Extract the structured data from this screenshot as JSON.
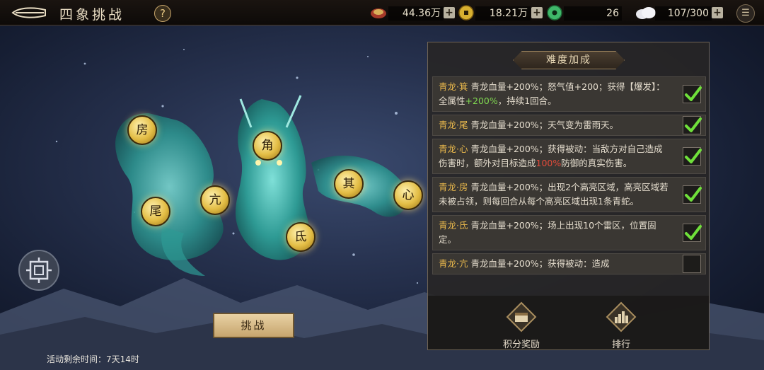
{
  "header": {
    "title": "四象挑战",
    "help_label": "?",
    "menu_label": "☰",
    "resources": [
      {
        "name": "treasure-icon",
        "value": "44.36万"
      },
      {
        "name": "copper-coin-icon",
        "value": "18.21万"
      },
      {
        "name": "jade-icon",
        "value": "26"
      },
      {
        "name": "stamina-cloud-icon",
        "value": "107/300"
      }
    ],
    "plus_label": "+"
  },
  "stars": [
    "房",
    "角",
    "亢",
    "其",
    "心",
    "尾",
    "氐"
  ],
  "panel": {
    "title": "难度加成",
    "rows": [
      {
        "name": "青龙·箕",
        "parts": [
          {
            "t": "青龙血量+200%；怒气值+200；获得【爆发】：全属性"
          },
          {
            "t": "+200%",
            "c": "g"
          },
          {
            "t": "，持续1回合。"
          }
        ],
        "checked": true
      },
      {
        "name": "青龙·尾",
        "parts": [
          {
            "t": "青龙血量+200%；天气变为雷雨天。"
          }
        ],
        "checked": true
      },
      {
        "name": "青龙·心",
        "parts": [
          {
            "t": "青龙血量+200%；获得被动：当敌方对自己造成伤害时，额外对目标造成"
          },
          {
            "t": "100%",
            "c": "r"
          },
          {
            "t": "防御的真实伤害。"
          }
        ],
        "checked": true
      },
      {
        "name": "青龙·房",
        "parts": [
          {
            "t": "青龙血量+200%；出现2个高亮区域，高亮区域若未被占领，则每回合从每个高亮区域出现1条青蛇。"
          }
        ],
        "checked": true
      },
      {
        "name": "青龙·氐",
        "parts": [
          {
            "t": "青龙血量+200%；场上出现10个雷区，位置固定。"
          }
        ],
        "checked": true
      },
      {
        "name": "青龙·亢",
        "parts": [
          {
            "t": "青龙血量+200%；获得被动：造成"
          }
        ],
        "checked": false
      }
    ],
    "rewards_label": "积分奖励",
    "ranking_label": "排行"
  },
  "challenge_button": "挑战",
  "time_left": "活动剩余时间：7天14时"
}
